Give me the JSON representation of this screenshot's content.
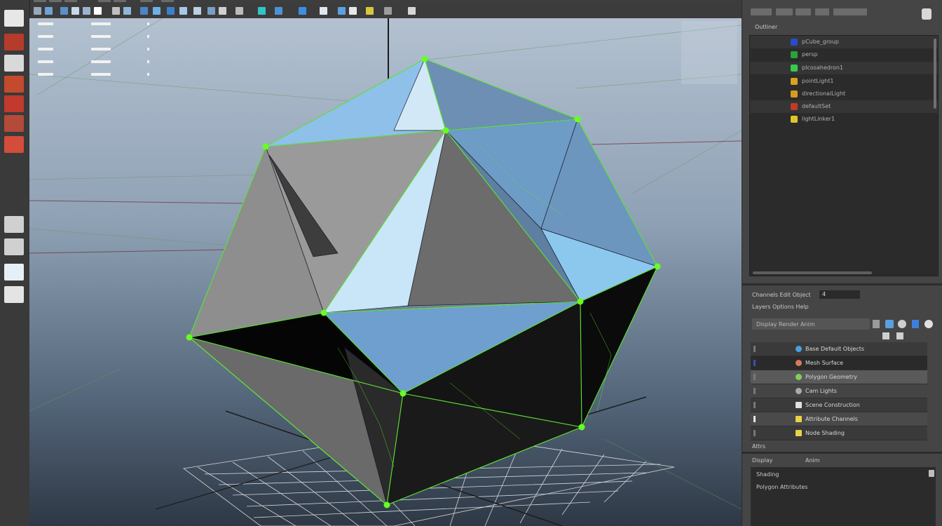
{
  "outliner": {
    "header_label": "Outliner",
    "rows": [
      {
        "label": "pCube_group",
        "icon_color": "#2a4cc8"
      },
      {
        "label": "persp",
        "icon_color": "#29a33a"
      },
      {
        "label": "pIcosahedron1",
        "icon_color": "#38c94c"
      },
      {
        "label": "pointLight1",
        "icon_color": "#d9a21f"
      },
      {
        "label": "directionalLight",
        "icon_color": "#d79a1e"
      },
      {
        "label": "defaultSet",
        "icon_color": "#c23b2a"
      },
      {
        "label": "lightLinker1",
        "icon_color": "#e0c42a"
      }
    ]
  },
  "channel_box": {
    "field_value": "4",
    "row1": "Channels Edit Object",
    "row2": "Layers Options Help",
    "search_placeholder": "Display Render Anim"
  },
  "layers": {
    "rows": [
      {
        "label": "Base Default Objects",
        "icon_color": "#4aa0e0"
      },
      {
        "label": "Mesh Surface",
        "icon_color": "#d97a5a"
      },
      {
        "label": "Polygon Geometry",
        "icon_color": "#7fcf5a"
      },
      {
        "label": "Cam Lights",
        "icon_color": "#aaaaaa"
      },
      {
        "label": "Scene Construction",
        "icon_color": "#e0e0e0"
      },
      {
        "label": "Attribute Channels",
        "icon_color": "#e8d34a"
      },
      {
        "label": "Node Shading",
        "icon_color": "#e8d34a"
      }
    ]
  },
  "bottom_panel": {
    "header": "Attrs",
    "tabs": [
      "Display",
      "Anim"
    ],
    "title": "Shading",
    "subtitle": "Polygon Attributes"
  },
  "colors": {
    "wire_green": "#5ee833",
    "face_blue": "#7fb2e0",
    "face_grey": "#8d8d8d",
    "vertex_green": "#66ff22"
  }
}
